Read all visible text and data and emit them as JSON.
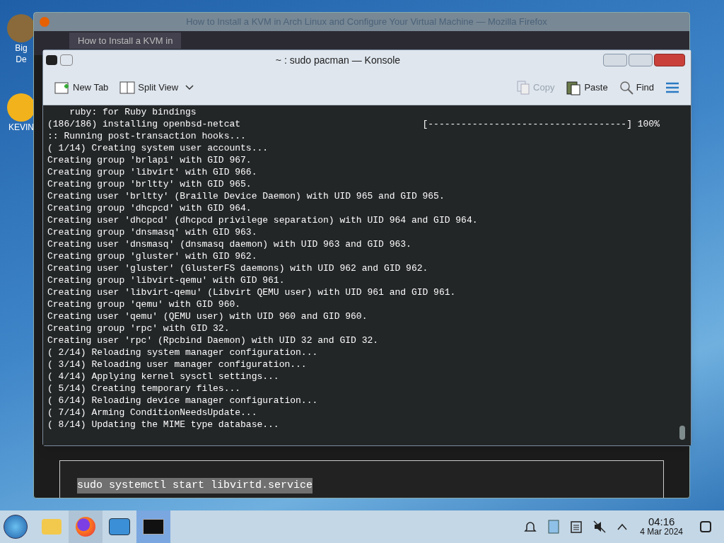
{
  "desktop_icons": [
    {
      "lines": [
        "Big",
        "De"
      ]
    },
    {
      "lines": [
        "KEVIN"
      ]
    }
  ],
  "browser_window": {
    "title": "How to Install a KVM in Arch Linux and Configure Your Virtual Machine — Mozilla Firefox",
    "tab": {
      "label": "How to Install a KVM in",
      "selected": true
    },
    "code_block": "sudo systemctl start libvirtd.service"
  },
  "konsole": {
    "title": "~ : sudo pacman — Konsole",
    "toolbar": [
      {
        "kind": "new-tab",
        "label": "New Tab",
        "disabled": false
      },
      {
        "kind": "split-view",
        "label": "Split View",
        "disabled": false
      },
      {
        "kind": "copy",
        "label": "Copy",
        "disabled": true
      },
      {
        "kind": "paste",
        "label": "Paste",
        "disabled": false
      },
      {
        "kind": "find",
        "label": "Find",
        "disabled": false
      }
    ],
    "lines": [
      {
        "text": "    ruby: for Ruby bindings"
      },
      {
        "text": "(186/186) installing openbsd-netcat",
        "progress": "[------------------------------------] 100%"
      },
      {
        "text": ":: Running post-transaction hooks..."
      },
      {
        "text": "( 1/14) Creating system user accounts..."
      },
      {
        "text": "Creating group 'brlapi' with GID 967."
      },
      {
        "text": "Creating group 'libvirt' with GID 966."
      },
      {
        "text": "Creating group 'brltty' with GID 965."
      },
      {
        "text": "Creating user 'brltty' (Braille Device Daemon) with UID 965 and GID 965."
      },
      {
        "text": "Creating group 'dhcpcd' with GID 964."
      },
      {
        "text": "Creating user 'dhcpcd' (dhcpcd privilege separation) with UID 964 and GID 964."
      },
      {
        "text": "Creating group 'dnsmasq' with GID 963."
      },
      {
        "text": "Creating user 'dnsmasq' (dnsmasq daemon) with UID 963 and GID 963."
      },
      {
        "text": "Creating group 'gluster' with GID 962."
      },
      {
        "text": "Creating user 'gluster' (GlusterFS daemons) with UID 962 and GID 962."
      },
      {
        "text": "Creating group 'libvirt-qemu' with GID 961."
      },
      {
        "text": "Creating user 'libvirt-qemu' (Libvirt QEMU user) with UID 961 and GID 961."
      },
      {
        "text": "Creating group 'qemu' with GID 960."
      },
      {
        "text": "Creating user 'qemu' (QEMU user) with UID 960 and GID 960."
      },
      {
        "text": "Creating group 'rpc' with GID 32."
      },
      {
        "text": "Creating user 'rpc' (Rpcbind Daemon) with UID 32 and GID 32."
      },
      {
        "text": "( 2/14) Reloading system manager configuration..."
      },
      {
        "text": "( 3/14) Reloading user manager configuration..."
      },
      {
        "text": "( 4/14) Applying kernel sysctl settings..."
      },
      {
        "text": "( 5/14) Creating temporary files..."
      },
      {
        "text": "( 6/14) Reloading device manager configuration..."
      },
      {
        "text": "( 7/14) Arming ConditionNeedsUpdate..."
      },
      {
        "text": "( 8/14) Updating the MIME type database..."
      }
    ]
  },
  "taskbar": {
    "apps": [
      {
        "kind": "files",
        "active": false
      },
      {
        "kind": "firefox",
        "active": true
      },
      {
        "kind": "settings",
        "active": false
      },
      {
        "kind": "terminal",
        "active": true
      }
    ],
    "clock": {
      "time": "04:16",
      "date": "4 Mar 2024"
    }
  }
}
